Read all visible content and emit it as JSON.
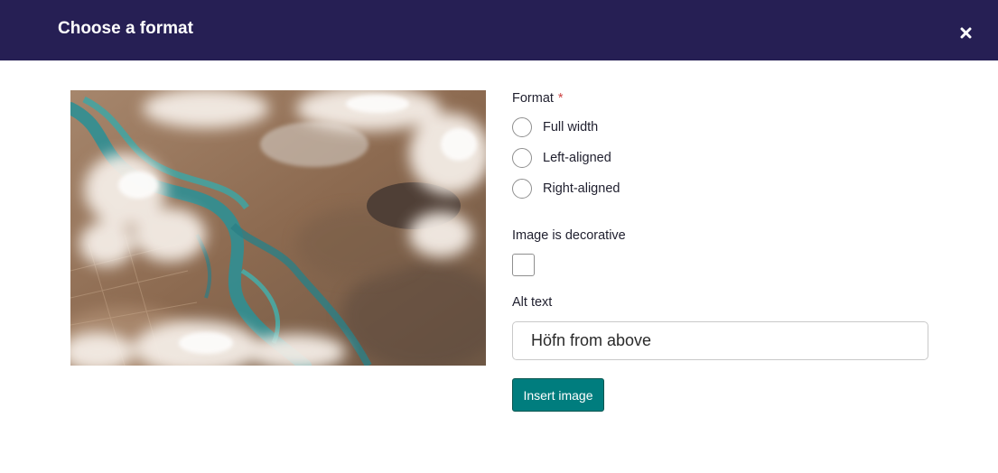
{
  "dialog": {
    "title": "Choose a format",
    "close_icon": "close-icon"
  },
  "preview": {
    "icon": "aerial-river-landscape-image"
  },
  "format": {
    "label": "Format",
    "required_mark": "*",
    "options": [
      {
        "label": "Full width",
        "selected": false
      },
      {
        "label": "Left-aligned",
        "selected": false
      },
      {
        "label": "Right-aligned",
        "selected": false
      }
    ]
  },
  "decorative": {
    "label": "Image is decorative",
    "checked": false
  },
  "alt_text": {
    "label": "Alt text",
    "value": "Höfn from above"
  },
  "submit": {
    "label": "Insert image"
  },
  "colors": {
    "header_background": "#261f54",
    "primary_button": "#007d7e",
    "required": "#cd4444"
  }
}
